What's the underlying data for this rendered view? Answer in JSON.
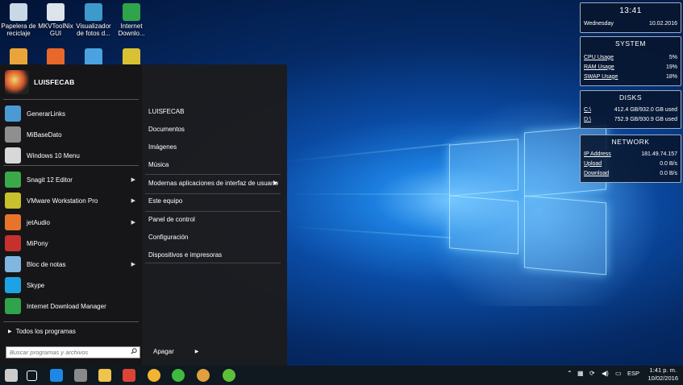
{
  "desktop": {
    "icons": [
      {
        "label": "Papelera de reciclaje",
        "icon": "recycle-bin-icon",
        "color": "#c9d7e6"
      },
      {
        "label": "MKVToolNix GUI",
        "icon": "mkvtoolnix-icon",
        "color": "#dde4ea"
      },
      {
        "label": "Visualizador de fotos d...",
        "icon": "photo-viewer-icon",
        "color": "#3d9acb"
      },
      {
        "label": "Internet Downlo...",
        "icon": "idm-icon",
        "color": "#2fa44a"
      }
    ],
    "second_row_icons": [
      {
        "icon": "app-icon-1",
        "color": "#e9a53a"
      },
      {
        "icon": "firefox-icon",
        "color": "#e8672b"
      },
      {
        "icon": "app-icon-3",
        "color": "#4aa3e0"
      },
      {
        "icon": "app-icon-4",
        "color": "#d8c233"
      }
    ]
  },
  "start_menu": {
    "user_name": "LUISFECAB",
    "programs": [
      {
        "label": "GenerarLinks",
        "icon": "generarlinks-icon",
        "color": "#4c9ad5",
        "submenu": false
      },
      {
        "label": "MiBaseDato",
        "icon": "mibasedato-icon",
        "color": "#8f8f8f",
        "submenu": false
      },
      {
        "label": "Windows 10 Menu",
        "icon": "windows10menu-icon",
        "color": "#d8d8d8",
        "submenu": false
      },
      {
        "label": "Snagit 12 Editor",
        "icon": "snagit-icon",
        "color": "#3ba94a",
        "submenu": true
      },
      {
        "label": "VMware Workstation Pro",
        "icon": "vmware-icon",
        "color": "#c9c02d",
        "submenu": true
      },
      {
        "label": "jetAudio",
        "icon": "jetaudio-icon",
        "color": "#e8732a",
        "submenu": true
      },
      {
        "label": "MiPony",
        "icon": "mipony-icon",
        "color": "#c7312d",
        "submenu": false
      },
      {
        "label": "Bloc de notas",
        "icon": "notepad-icon",
        "color": "#7fb7e0",
        "submenu": true
      },
      {
        "label": "Skype",
        "icon": "skype-icon",
        "color": "#1ea2e6",
        "submenu": false
      },
      {
        "label": "Internet Download Manager",
        "icon": "idm-icon",
        "color": "#2fa44a",
        "submenu": false
      }
    ],
    "all_programs": "Todos los programas",
    "search_placeholder": "Buscar programas y archivos",
    "right_items": [
      {
        "label": "LUISFECAB",
        "submenu": false
      },
      {
        "label": "Documentos",
        "submenu": false
      },
      {
        "label": "Imágenes",
        "submenu": false
      },
      {
        "label": "Música",
        "submenu": false
      },
      {
        "label": "Modernas aplicaciones de interfaz de usuario",
        "submenu": true
      },
      {
        "label": "Este equipo",
        "submenu": false
      },
      {
        "label": "Panel de control",
        "submenu": false
      },
      {
        "label": "Configuración",
        "submenu": false
      },
      {
        "label": "Dispositivos e impresoras",
        "submenu": false
      }
    ],
    "shutdown_label": "Apagar"
  },
  "gadgets": {
    "clock": {
      "time": "13:41",
      "day": "Wednesday",
      "date": "10.02.2016"
    },
    "system": {
      "title": "SYSTEM",
      "rows": [
        {
          "label": "CPU Usage",
          "value": "5%"
        },
        {
          "label": "RAM Usage",
          "value": "19%"
        },
        {
          "label": "SWAP Usage",
          "value": "18%"
        }
      ]
    },
    "disks": {
      "title": "DISKS",
      "rows": [
        {
          "label": "C:\\",
          "value": "412.4 GB/932.0 GB used"
        },
        {
          "label": "D:\\",
          "value": "752.9 GB/930.9 GB used"
        }
      ]
    },
    "network": {
      "title": "NETWORK",
      "rows": [
        {
          "label": "IP Address",
          "value": "181.49.74.157"
        },
        {
          "label": "Upload",
          "value": "0.0 B/s"
        },
        {
          "label": "Download",
          "value": "0.0 B/s"
        }
      ]
    }
  },
  "taskbar": {
    "pinned": [
      {
        "icon": "biohazard-start-icon",
        "color": "#cccccc"
      },
      {
        "icon": "task-view-icon",
        "color": "#ffffff"
      },
      {
        "icon": "edge-icon",
        "color": "#1e88e5"
      },
      {
        "icon": "app-icon",
        "color": "#8a8a8a"
      },
      {
        "icon": "file-explorer-icon",
        "color": "#f0c44c"
      },
      {
        "icon": "chrome-icon",
        "color": "#db4437"
      },
      {
        "icon": "emoji-app-icon",
        "color": "#f2b533"
      },
      {
        "icon": "green-app-icon",
        "color": "#3dbb3d"
      },
      {
        "icon": "avatar-app-icon",
        "color": "#e0a040"
      },
      {
        "icon": "download-app-icon",
        "color": "#5cbf3a"
      }
    ],
    "language": "ESP",
    "time": "1:41 p. m.",
    "date": "10/02/2016"
  }
}
